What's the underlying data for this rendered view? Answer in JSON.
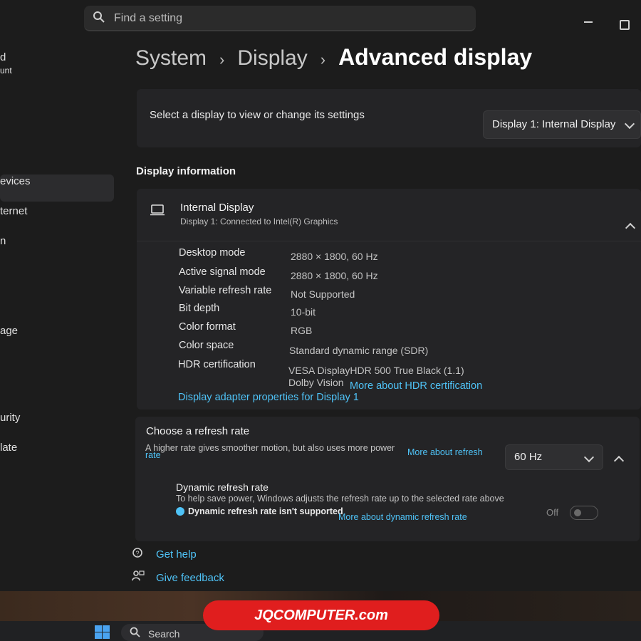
{
  "search": {
    "placeholder": "Find a setting"
  },
  "sidebar": {
    "items": [
      {
        "label": "d"
      },
      {
        "label": "unt"
      },
      {
        "label": "evices"
      },
      {
        "label": "ternet"
      },
      {
        "label": "n"
      },
      {
        "label": "age"
      },
      {
        "label": "urity"
      },
      {
        "label": "late"
      }
    ]
  },
  "breadcrumb": {
    "items": [
      "System",
      "Display"
    ],
    "current": "Advanced display"
  },
  "display_select": {
    "label": "Select a display to view or change its settings",
    "value": "Display 1: Internal Display"
  },
  "display_info": {
    "section_title": "Display information",
    "title": "Internal Display",
    "subtitle": "Display 1: Connected to Intel(R) Graphics",
    "properties": [
      {
        "label": "Desktop mode",
        "value": "2880 × 1800, 60 Hz"
      },
      {
        "label": "Active signal mode",
        "value": "2880 × 1800, 60 Hz"
      },
      {
        "label": "Variable refresh rate",
        "value": "Not Supported"
      },
      {
        "label": "Bit depth",
        "value": "10-bit"
      },
      {
        "label": "Color format",
        "value": "RGB"
      },
      {
        "label": "Color space",
        "value": "Standard dynamic range (SDR)"
      },
      {
        "label": "HDR certification",
        "value": "VESA DisplayHDR 500 True Black (1.1)"
      }
    ],
    "hdr_extra": "Dolby Vision",
    "hdr_link": "More about HDR certification",
    "adapter_link": "Display adapter properties for Display 1"
  },
  "refresh": {
    "title": "Choose a refresh rate",
    "desc": "A higher rate gives smoother motion, but also uses more power",
    "more_link_a": "More about refresh",
    "more_link_b": "rate",
    "value": "60 Hz",
    "dynamic_title": "Dynamic refresh rate",
    "dynamic_desc": "To help save power, Windows adjusts the refresh rate up to the selected rate above",
    "dynamic_notsupported": "Dynamic refresh rate isn't supported",
    "dynamic_link": "More about dynamic refresh rate",
    "toggle_label": "Off",
    "toggle_on": false
  },
  "footer": {
    "help": "Get help",
    "feedback": "Give feedback"
  },
  "taskbar": {
    "search": "Search"
  },
  "watermark": "JQCOMPUTER.com",
  "colors": {
    "accent": "#4fc3f7",
    "brand_red": "#e01e1e",
    "background": "#1c1c1c"
  }
}
